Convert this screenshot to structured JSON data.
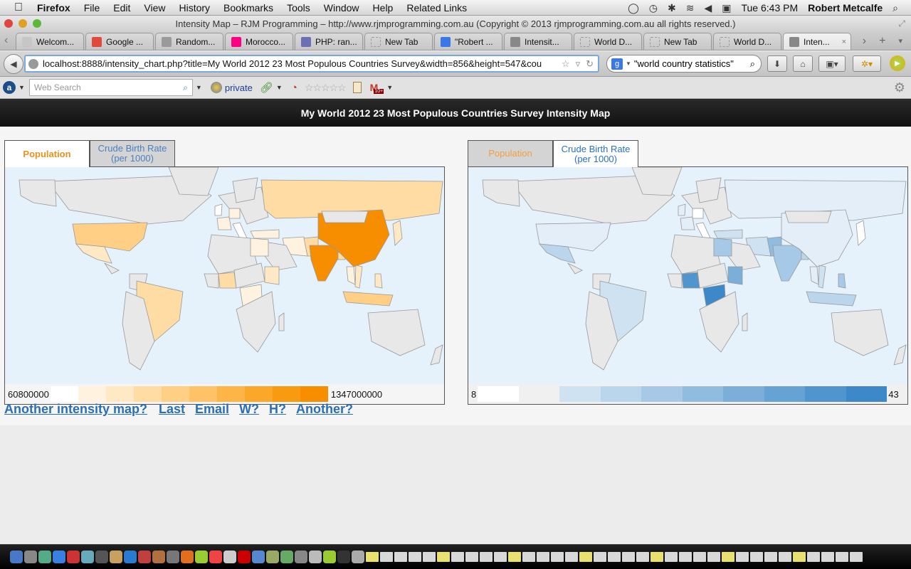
{
  "menubar": {
    "apple": "",
    "items": [
      "Firefox",
      "File",
      "Edit",
      "View",
      "History",
      "Bookmarks",
      "Tools",
      "Window",
      "Help",
      "Related Links"
    ],
    "clock": "Tue 6:43 PM",
    "user": "Robert Metcalfe",
    "status_icons": [
      "skype-icon",
      "time-machine-icon",
      "bluetooth-icon",
      "wifi-icon",
      "volume-icon",
      "activity-monitor-icon"
    ]
  },
  "window": {
    "title": "Intensity Map – RJM Programming – http://www.rjmprogramming.com.au (Copyright © 2013 rjmprogramming.com.au all rights reserved.)"
  },
  "tabs": [
    {
      "label": "Welcom...",
      "icon": "blank",
      "color": "#c6c6c6"
    },
    {
      "label": "Google ...",
      "icon": "google-icon",
      "color": "#e04a3c"
    },
    {
      "label": "Random...",
      "icon": "image-icon",
      "color": "#9a9a9a"
    },
    {
      "label": "Morocco...",
      "icon": "flickr-icon",
      "color": "#ff0084"
    },
    {
      "label": "PHP: ran...",
      "icon": "php-icon",
      "color": "#6b6fb4"
    },
    {
      "label": "New Tab",
      "icon": "blank-page-icon",
      "color": "#d0d0d0"
    },
    {
      "label": "\"Robert ...",
      "icon": "google-icon",
      "color": "#3b78e7"
    },
    {
      "label": "Intensit...",
      "icon": "globe-icon",
      "color": "#888888"
    },
    {
      "label": "World D...",
      "icon": "blank-page-icon",
      "color": "#d0d0d0"
    },
    {
      "label": "New Tab",
      "icon": "blank-page-icon",
      "color": "#d0d0d0"
    },
    {
      "label": "World D...",
      "icon": "blank-page-icon",
      "color": "#d0d0d0"
    },
    {
      "label": "Inten...",
      "icon": "globe-icon",
      "color": "#888888",
      "active": true
    }
  ],
  "tab_controls": {
    "scroll_right": "›",
    "new_tab": "+",
    "list": "▾",
    "scroll_left": "‹",
    "close": "×"
  },
  "navbar": {
    "url": "localhost:8888/intensity_chart.php?title=My World 2012 23 Most Populous Countries Survey&width=856&height=547&cou",
    "search_value": "\"world country statistics\"",
    "search_engine": "g"
  },
  "toolbar2": {
    "search_placeholder": "Web Search",
    "private_label": "private",
    "stars": "☆☆☆☆☆",
    "mail_badge": "10+"
  },
  "page": {
    "heading": "My World 2012 23 Most Populous Countries Survey Intensity Map",
    "links": [
      "Another intensity map?",
      "Last",
      "Email",
      "W?",
      "H?",
      "Another?"
    ]
  },
  "maps": [
    {
      "tabs": [
        {
          "line1": "Population",
          "line2": "",
          "active": true,
          "color": "#e8911c"
        },
        {
          "line1": "Crude Birth Rate",
          "line2": "(per 1000)",
          "active": false,
          "color": "#4a80c0"
        }
      ],
      "legend_min": "60800000",
      "legend_max": "1347000000",
      "colors": [
        "#ffffff",
        "#fff3e0",
        "#ffe8c4",
        "#ffdca4",
        "#ffcf86",
        "#ffc266",
        "#fdb547",
        "#fba82a",
        "#f99b10",
        "#f68e00"
      ],
      "highlight_color": "#f68e00",
      "countries": {
        "China": 1347000000,
        "India": 1241000000,
        "USA": 312000000,
        "Indonesia": 238000000,
        "Brazil": 197000000,
        "Pakistan": 177000000,
        "Nigeria": 162000000,
        "Bangladesh": 150000000,
        "Russia": 143000000,
        "Japan": 128000000,
        "Mexico": 115000000,
        "Philippines": 95000000,
        "Vietnam": 88000000,
        "Ethiopia": 85000000,
        "Egypt": 83000000,
        "Germany": 82000000,
        "Iran": 75000000,
        "Turkey": 74000000,
        "Thailand": 70000000,
        "DR Congo": 68000000,
        "France": 63000000,
        "UK": 62000000,
        "Italy": 60800000
      }
    },
    {
      "tabs": [
        {
          "line1": "Population",
          "line2": "",
          "active": false,
          "color": "#f0a040"
        },
        {
          "line1": "Crude Birth Rate",
          "line2": "(per 1000)",
          "active": true,
          "color": "#2a70c0"
        }
      ],
      "legend_min": "8",
      "legend_max": "43",
      "colors": [
        "#ffffff",
        "#e3eef8",
        "#cfe2f2",
        "#bad6ec",
        "#a5c9e6",
        "#90bce0",
        "#7bafda",
        "#66a2d4",
        "#5195ce",
        "#3c88c8"
      ],
      "countries": {
        "DR Congo": 43,
        "Nigeria": 40,
        "Ethiopia": 31,
        "Pakistan": 28,
        "Egypt": 25,
        "India": 22,
        "Bangladesh": 20,
        "Philippines": 24,
        "Mexico": 19,
        "Indonesia": 18,
        "Turkey": 17,
        "Iran": 17,
        "Brazil": 15,
        "Vietnam": 16,
        "USA": 13,
        "France": 13,
        "UK": 13,
        "Russia": 12,
        "China": 12,
        "Thailand": 12,
        "Italy": 9,
        "Japan": 8,
        "Germany": 8
      }
    }
  ],
  "dock": {
    "icon_count": 60
  }
}
